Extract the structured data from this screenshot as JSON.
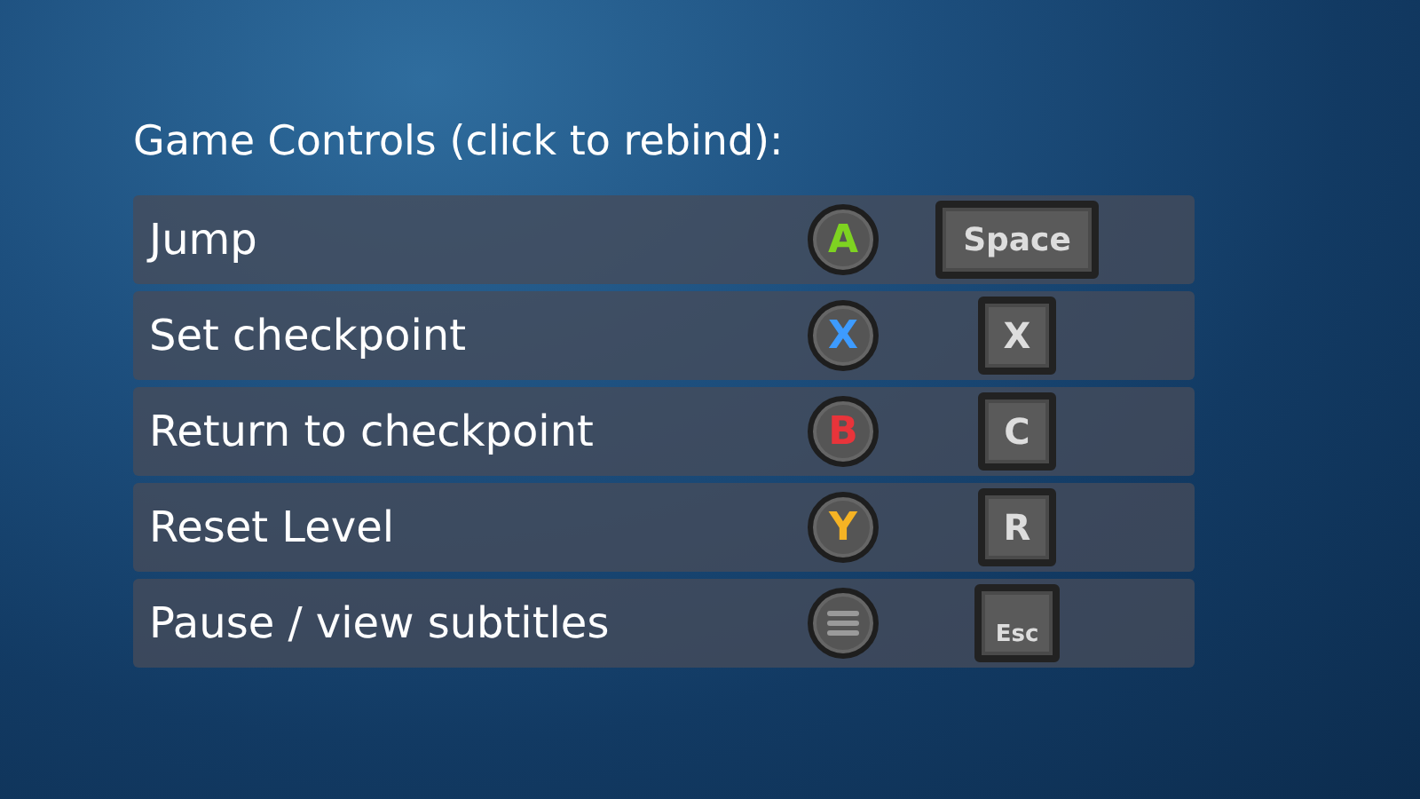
{
  "title": "Game Controls (click to rebind):",
  "controls": [
    {
      "action": "Jump",
      "pad": {
        "kind": "letter",
        "label": "A",
        "color": "#7ed321"
      },
      "key": {
        "label": "Space",
        "kind": "wide"
      }
    },
    {
      "action": "Set checkpoint",
      "pad": {
        "kind": "letter",
        "label": "X",
        "color": "#3d9bff"
      },
      "key": {
        "label": "X",
        "kind": "square"
      }
    },
    {
      "action": "Return to checkpoint",
      "pad": {
        "kind": "letter",
        "label": "B",
        "color": "#e8343a"
      },
      "key": {
        "label": "C",
        "kind": "square"
      }
    },
    {
      "action": "Reset Level",
      "pad": {
        "kind": "letter",
        "label": "Y",
        "color": "#f5b324"
      },
      "key": {
        "label": "R",
        "kind": "square"
      }
    },
    {
      "action": "Pause / view subtitles",
      "pad": {
        "kind": "menu"
      },
      "key": {
        "label": "Esc",
        "kind": "small"
      }
    }
  ]
}
